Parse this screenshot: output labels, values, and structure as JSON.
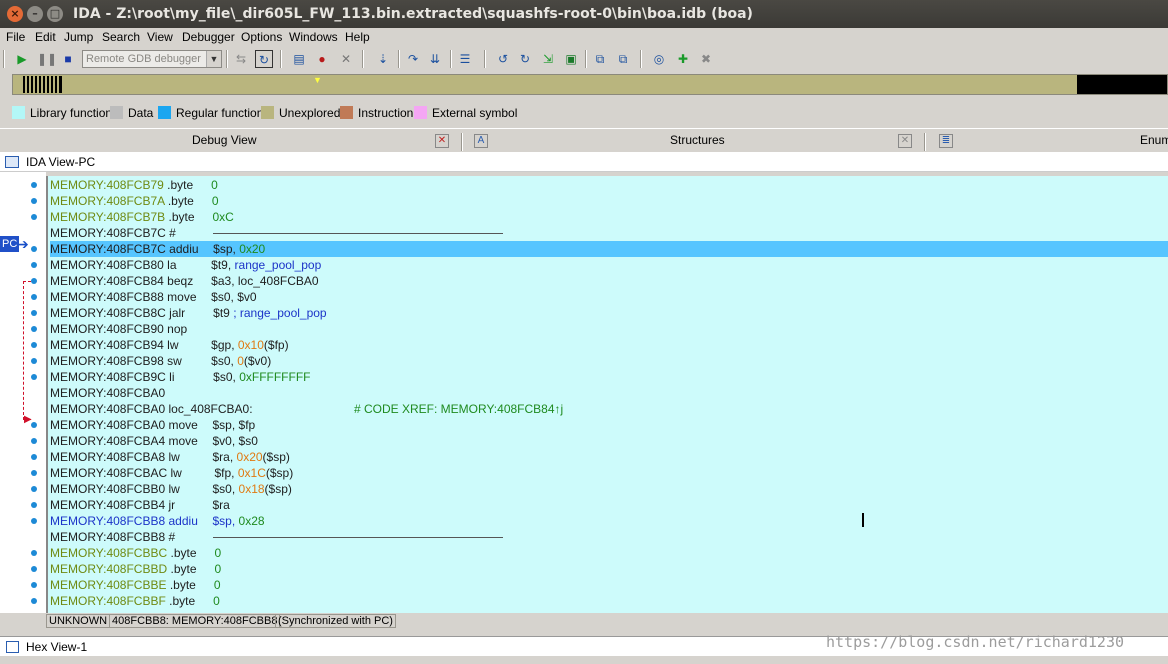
{
  "window": {
    "title": "IDA - Z:\\root\\my_file\\_dir605L_FW_113.bin.extracted\\squashfs-root-0\\bin\\boa.idb (boa)"
  },
  "menu": [
    "File",
    "Edit",
    "Jump",
    "Search",
    "View",
    "Debugger",
    "Options",
    "Windows",
    "Help"
  ],
  "toolbar": {
    "debugger_select": "Remote GDB debugger"
  },
  "legend": [
    {
      "label": "Library function",
      "color": "#b3f7f7"
    },
    {
      "label": "Data",
      "color": "#bcbcbc"
    },
    {
      "label": "Regular function",
      "color": "#1ba6f0"
    },
    {
      "label": "Unexplored",
      "color": "#b9b57e"
    },
    {
      "label": "Instruction",
      "color": "#c07a56"
    },
    {
      "label": "External symbol",
      "color": "#f4a6f4"
    }
  ],
  "panes": {
    "debug_view": "Debug View",
    "structures": "Structures",
    "enums": "Enum"
  },
  "ida_view": {
    "title": "IDA View-PC"
  },
  "pc_label": "PC",
  "listing": [
    {
      "addr": "MEMORY:408FCB79",
      "op": ".byte",
      "args": [
        {
          "t": "0",
          "c": "nm"
        }
      ]
    },
    {
      "addr": "MEMORY:408FCB7A",
      "op": ".byte",
      "args": [
        {
          "t": "0",
          "c": "nm"
        }
      ]
    },
    {
      "addr": "MEMORY:408FCB7B",
      "op": ".byte",
      "args": [
        {
          "t": "0xC",
          "c": "nm"
        }
      ]
    },
    {
      "addr": "MEMORY:408FCB7C",
      "op": "#",
      "sep": true
    },
    {
      "addr": "MEMORY:408FCB7C",
      "op": "addiu",
      "args": [
        {
          "t": "$sp, ",
          "c": "mn"
        },
        {
          "t": "0x20",
          "c": "nm"
        }
      ],
      "pc": true
    },
    {
      "addr": "MEMORY:408FCB80",
      "op": "la",
      "args": [
        {
          "t": "$t9, ",
          "c": "mn"
        },
        {
          "t": "range_pool_pop",
          "c": "fn"
        }
      ]
    },
    {
      "addr": "MEMORY:408FCB84",
      "op": "beqz",
      "args": [
        {
          "t": "$a3, loc_408FCBA0",
          "c": "mn"
        }
      ]
    },
    {
      "addr": "MEMORY:408FCB88",
      "op": "move",
      "args": [
        {
          "t": "$s0, $v0",
          "c": "mn"
        }
      ]
    },
    {
      "addr": "MEMORY:408FCB8C",
      "op": "jalr",
      "args": [
        {
          "t": "$t9 ",
          "c": "mn"
        },
        {
          "t": "; range_pool_pop",
          "c": "fn"
        }
      ]
    },
    {
      "addr": "MEMORY:408FCB90",
      "op": "nop",
      "args": []
    },
    {
      "addr": "MEMORY:408FCB94",
      "op": "lw",
      "args": [
        {
          "t": "$gp, ",
          "c": "mn"
        },
        {
          "t": "0x10",
          "c": "nm2"
        },
        {
          "t": "($fp)",
          "c": "mn"
        }
      ]
    },
    {
      "addr": "MEMORY:408FCB98",
      "op": "sw",
      "args": [
        {
          "t": "$s0, ",
          "c": "mn"
        },
        {
          "t": "0",
          "c": "nm2"
        },
        {
          "t": "($v0)",
          "c": "mn"
        }
      ]
    },
    {
      "addr": "MEMORY:408FCB9C",
      "op": "li",
      "args": [
        {
          "t": "$s0, ",
          "c": "mn"
        },
        {
          "t": "0xFFFFFFFF",
          "c": "nm"
        }
      ]
    },
    {
      "addr": "MEMORY:408FCBA0",
      "op": "",
      "args": []
    },
    {
      "addr": "MEMORY:408FCBA0",
      "op": "loc_408FCBA0:",
      "args": [],
      "xref": "# CODE XREF: MEMORY:408FCB84↑j"
    },
    {
      "addr": "MEMORY:408FCBA0",
      "op": "move",
      "args": [
        {
          "t": "$sp, $fp",
          "c": "mn"
        }
      ]
    },
    {
      "addr": "MEMORY:408FCBA4",
      "op": "move",
      "args": [
        {
          "t": "$v0, $s0",
          "c": "mn"
        }
      ]
    },
    {
      "addr": "MEMORY:408FCBA8",
      "op": "lw",
      "args": [
        {
          "t": "$ra, ",
          "c": "mn"
        },
        {
          "t": "0x20",
          "c": "nm2"
        },
        {
          "t": "($sp)",
          "c": "mn"
        }
      ]
    },
    {
      "addr": "MEMORY:408FCBAC",
      "op": "lw",
      "args": [
        {
          "t": "$fp, ",
          "c": "mn"
        },
        {
          "t": "0x1C",
          "c": "nm2"
        },
        {
          "t": "($sp)",
          "c": "mn"
        }
      ]
    },
    {
      "addr": "MEMORY:408FCBB0",
      "op": "lw",
      "args": [
        {
          "t": "$s0, ",
          "c": "mn"
        },
        {
          "t": "0x18",
          "c": "nm2"
        },
        {
          "t": "($sp)",
          "c": "mn"
        }
      ]
    },
    {
      "addr": "MEMORY:408FCBB4",
      "op": "jr",
      "args": [
        {
          "t": "$ra",
          "c": "mn"
        }
      ]
    },
    {
      "addr": "MEMORY:408FCBB8",
      "op": "addiu",
      "args": [
        {
          "t": "$sp, ",
          "c": "mn"
        },
        {
          "t": "0x28",
          "c": "nm"
        }
      ],
      "blue": true
    },
    {
      "addr": "MEMORY:408FCBB8",
      "op": "#",
      "sep": true
    },
    {
      "addr": "MEMORY:408FCBBC",
      "op": ".byte",
      "args": [
        {
          "t": "0",
          "c": "nm"
        }
      ]
    },
    {
      "addr": "MEMORY:408FCBBD",
      "op": ".byte",
      "args": [
        {
          "t": "0",
          "c": "nm"
        }
      ]
    },
    {
      "addr": "MEMORY:408FCBBE",
      "op": ".byte",
      "args": [
        {
          "t": "0",
          "c": "nm"
        }
      ]
    },
    {
      "addr": "MEMORY:408FCBBF",
      "op": ".byte",
      "args": [
        {
          "t": "0",
          "c": "nm"
        }
      ]
    }
  ],
  "status": {
    "state": "UNKNOWN",
    "location": "408FCBB8: MEMORY:408FCBB8",
    "sync": "(Synchronized with PC)"
  },
  "hex_view": {
    "title": "Hex View-1"
  },
  "watermark": "https://blog.csdn.net/richard1230"
}
